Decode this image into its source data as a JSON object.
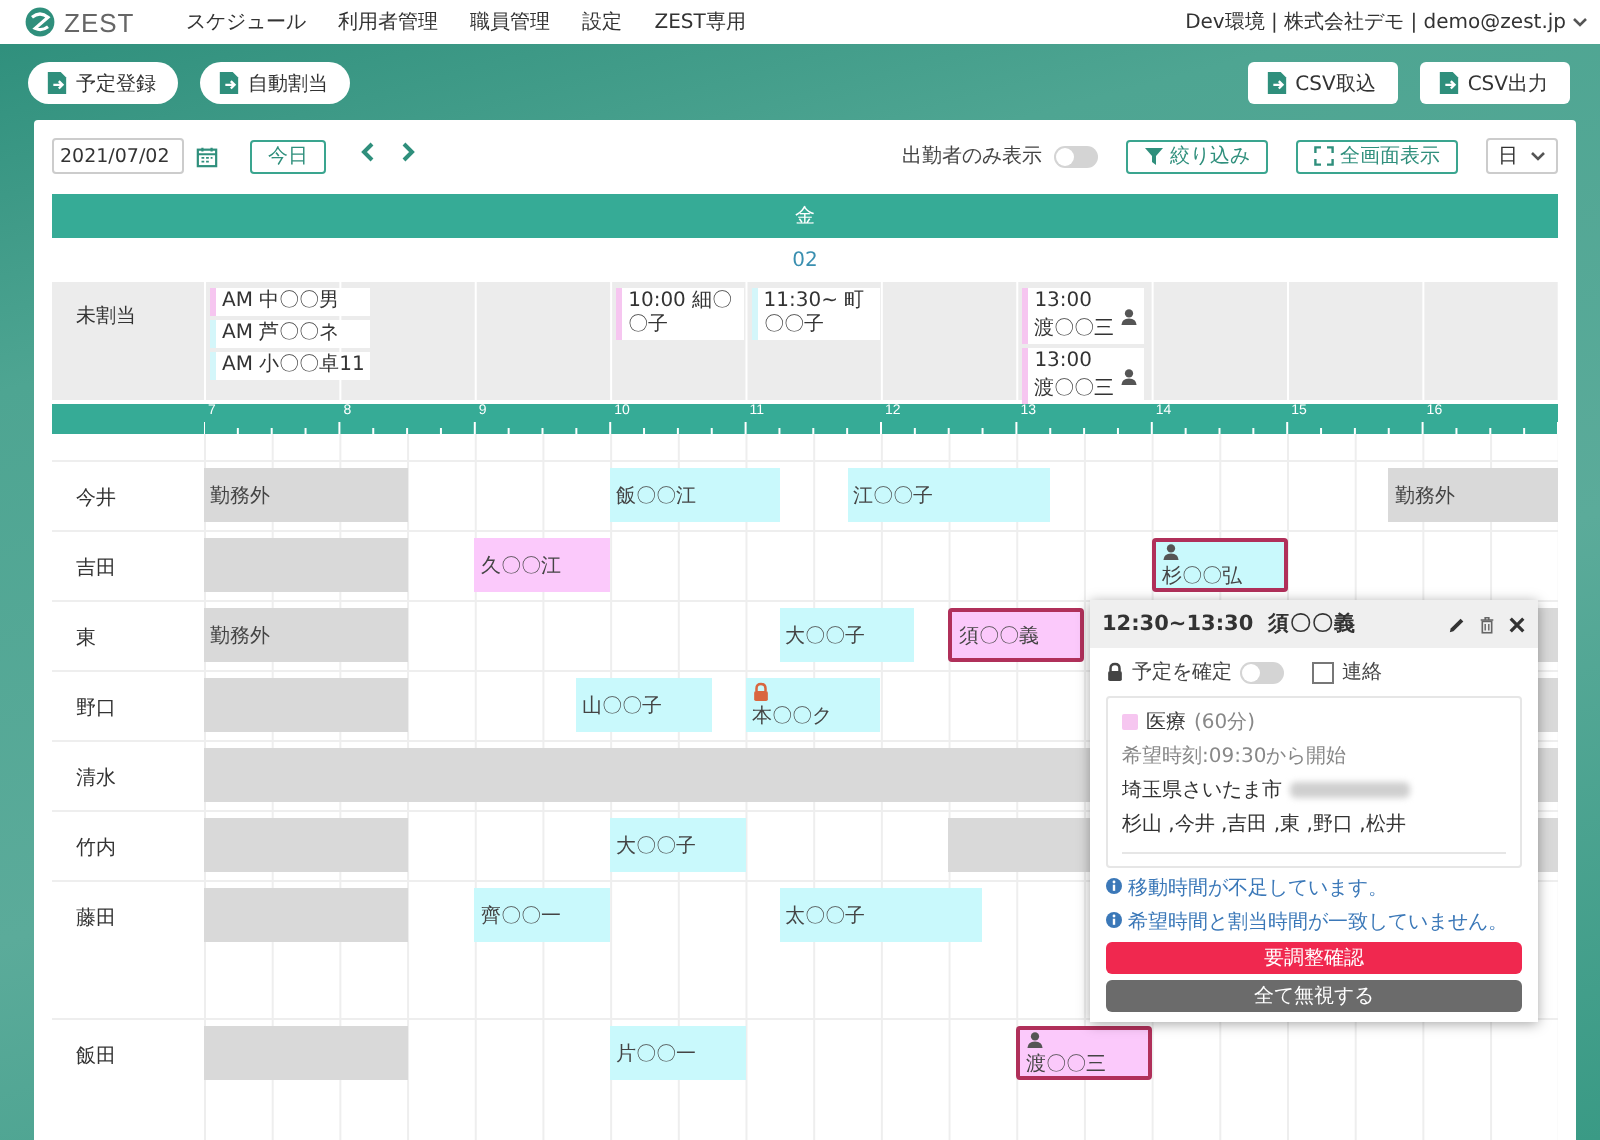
{
  "nav": {
    "brand": "ZEST",
    "menu": [
      "スケジュール",
      "利用者管理",
      "職員管理",
      "設定",
      "ZEST専用"
    ],
    "account": "Dev環境 | 株式会社デモ | demo@zest.jp"
  },
  "actions_left": [
    "予定登録",
    "自動割当"
  ],
  "actions_right": [
    "CSV取込",
    "CSV出力"
  ],
  "toolbar": {
    "date": "2021/07/02",
    "today": "今日",
    "attendance": {
      "label": "出勤者のみ表示",
      "on": false
    },
    "filter": "絞り込み",
    "fullscreen": "全画面表示",
    "view": "日"
  },
  "day": {
    "weekday": "金",
    "date": "02"
  },
  "unassigned": {
    "label": "未割当",
    "slots": [
      {
        "items": [
          {
            "kind": "inline",
            "text": "AM 中〇〇男",
            "color": "#f6c6f0",
            "designated": false
          },
          {
            "kind": "inline",
            "text": "AM 芦〇〇ネ",
            "color": "#d4f6fa",
            "designated": false
          },
          {
            "kind": "inline",
            "text": "AM 小〇〇卓11",
            "color": "#d4f6fa",
            "designated": false
          }
        ]
      },
      {
        "items": [
          {
            "kind": "inline",
            "text": "10:00 細〇〇子",
            "color": "#f6c6f0",
            "designated": false
          }
        ]
      },
      {
        "items": [
          {
            "kind": "inline",
            "text": "11:30~ 町〇〇子",
            "color": "#d4f6fa",
            "designated": false
          }
        ]
      },
      {
        "items": [
          {
            "kind": "stacked",
            "time": "13:00",
            "text": "渡〇〇三",
            "color": "#f6c6f0",
            "designated": true
          },
          {
            "kind": "stacked",
            "time": "13:00",
            "text": "渡〇〇三",
            "color": "#f6c6f0",
            "designated": true
          }
        ]
      }
    ]
  },
  "hours": [
    "7",
    "8",
    "9",
    "10",
    "11",
    "12",
    "13",
    "14",
    "15",
    "16"
  ],
  "rows": [
    {
      "name": "今井",
      "tall": false,
      "events": [
        {
          "kind": "off",
          "label": "勤務外"
        },
        {
          "kind": "visit",
          "label": "飯〇〇江",
          "color": "#c9f9fc",
          "alert": false,
          "designated": false,
          "locked": false
        },
        {
          "kind": "visit",
          "label": "江〇〇子",
          "color": "#c9f9fc",
          "alert": false,
          "designated": false,
          "locked": false
        },
        {
          "kind": "off",
          "label": "勤務外"
        }
      ]
    },
    {
      "name": "吉田",
      "tall": false,
      "events": [
        {
          "kind": "off"
        },
        {
          "kind": "visit",
          "label": "久〇〇江",
          "color": "#fbc9fb",
          "alert": false,
          "designated": false,
          "locked": false
        },
        {
          "kind": "visit",
          "label": "杉〇〇弘",
          "color": "#c9f9fc",
          "alert": true,
          "designated": true,
          "locked": false
        }
      ]
    },
    {
      "name": "東",
      "tall": false,
      "events": [
        {
          "kind": "off",
          "label": "勤務外"
        },
        {
          "kind": "visit",
          "label": "大〇〇子",
          "color": "#c9f9fc",
          "alert": false,
          "designated": false,
          "locked": false
        },
        {
          "kind": "visit",
          "label": "須〇〇義",
          "color": "#fbc9fb",
          "alert": true,
          "designated": false,
          "locked": false
        },
        {
          "kind": "off"
        }
      ]
    },
    {
      "name": "野口",
      "tall": false,
      "events": [
        {
          "kind": "off"
        },
        {
          "kind": "visit",
          "label": "山〇〇子",
          "color": "#c9f9fc",
          "alert": false,
          "designated": false,
          "locked": false
        },
        {
          "kind": "visit",
          "label": "本〇〇ク",
          "color": "#c9f9fc",
          "alert": false,
          "designated": false,
          "locked": true
        },
        {
          "kind": "off"
        }
      ]
    },
    {
      "name": "清水",
      "tall": false,
      "events": [
        {
          "kind": "off"
        }
      ]
    },
    {
      "name": "竹内",
      "tall": false,
      "events": [
        {
          "kind": "off"
        },
        {
          "kind": "visit",
          "label": "大〇〇子",
          "color": "#c9f9fc",
          "alert": false,
          "designated": false,
          "locked": false
        },
        {
          "kind": "off"
        }
      ]
    },
    {
      "name": "藤田",
      "tall": true,
      "events": [
        {
          "kind": "off"
        },
        {
          "kind": "visit",
          "label": "齊〇〇一",
          "color": "#c9f9fc",
          "alert": false,
          "designated": false,
          "locked": false
        },
        {
          "kind": "visit",
          "label": "太〇〇子",
          "color": "#c9f9fc",
          "alert": false,
          "designated": false,
          "locked": false
        }
      ]
    },
    {
      "name": "飯田",
      "tall": true,
      "events": [
        {
          "kind": "off"
        },
        {
          "kind": "visit",
          "label": "片〇〇一",
          "color": "#c9f9fc",
          "alert": false,
          "designated": false,
          "locked": false
        },
        {
          "kind": "visit",
          "label": "渡〇〇三",
          "color": "#fbc9fb",
          "alert": true,
          "designated": true,
          "locked": false
        }
      ]
    }
  ],
  "popup": {
    "time": "12:30~13:30",
    "name": "須〇〇義",
    "confirm": {
      "label": "予定を確定",
      "on": false
    },
    "contact": {
      "label": "連絡",
      "checked": false
    },
    "service": {
      "name": "医療",
      "duration": "(60分)",
      "color": "#f6c6f0"
    },
    "wish": "希望時刻:09:30から開始",
    "address": "埼玉県さいたま市",
    "staff": "杉山 ,今井 ,吉田 ,東 ,野口 ,松井",
    "notices": [
      "移動時間が不足しています。",
      "希望時間と割当時間が一致していません。"
    ],
    "primary": "要調整確認",
    "secondary": "全て無視する"
  }
}
